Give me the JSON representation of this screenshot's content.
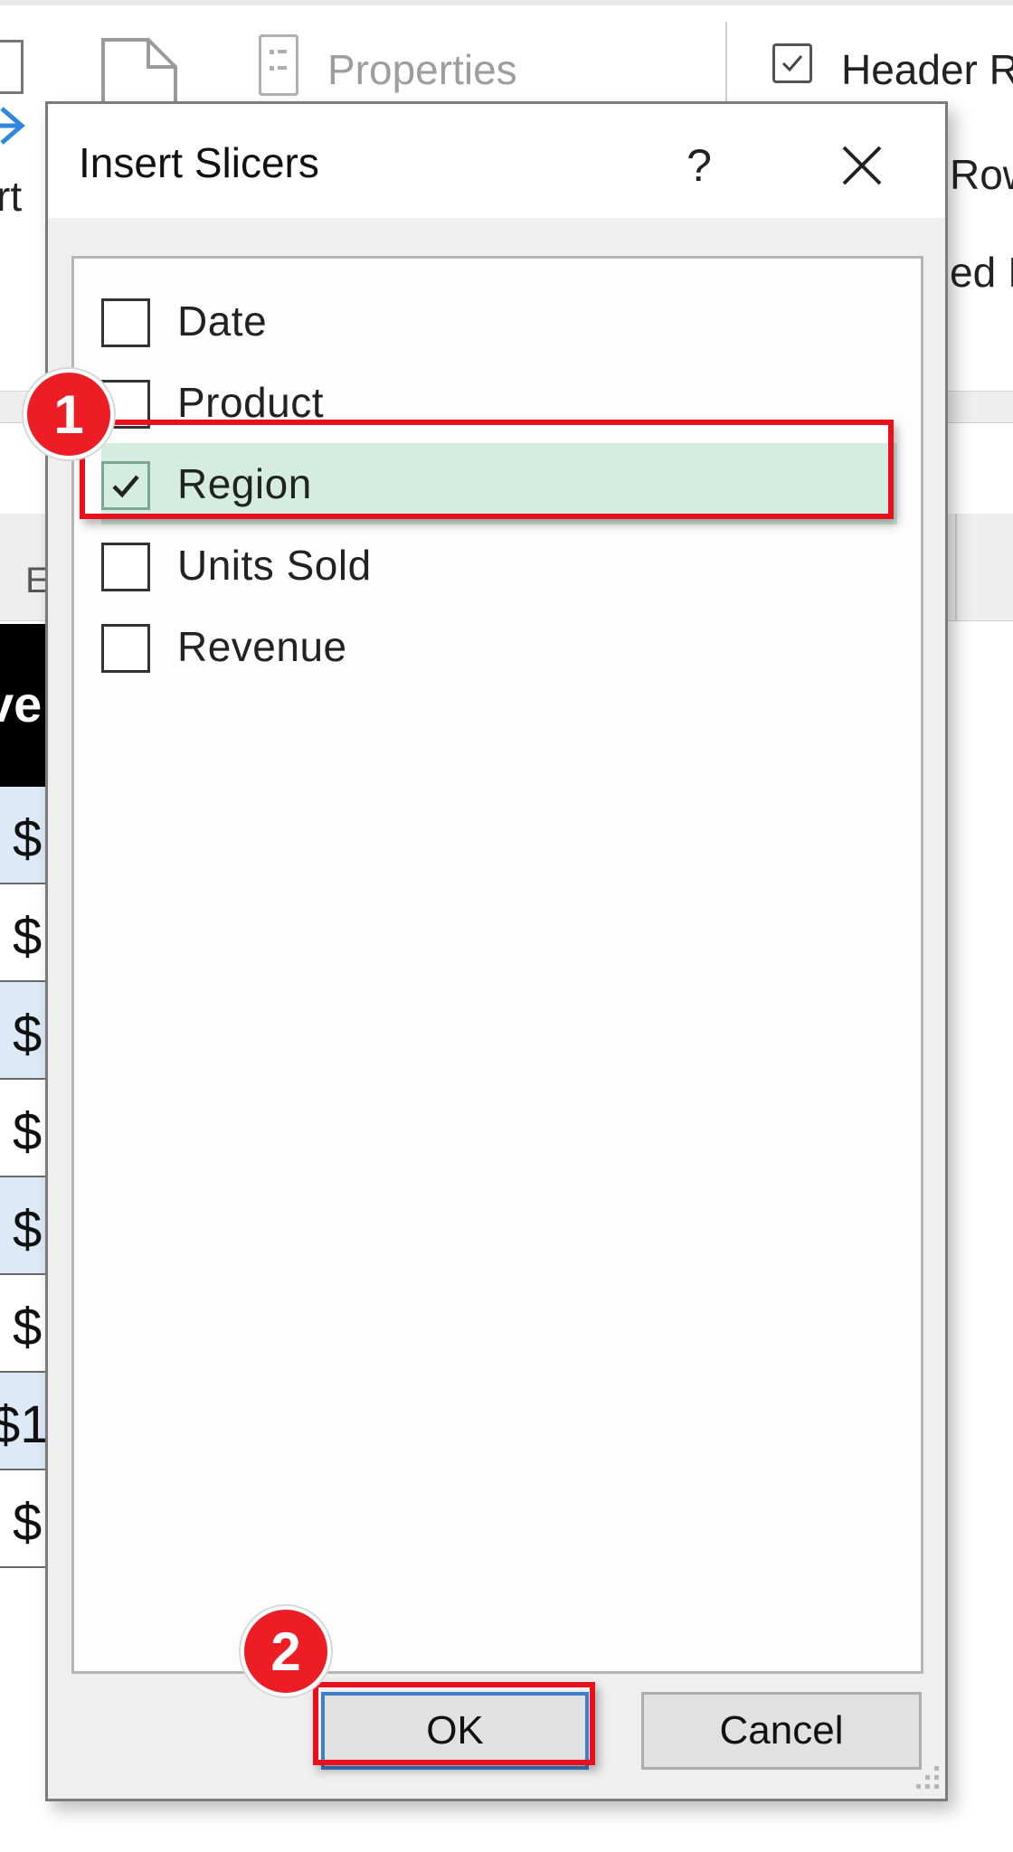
{
  "ribbon": {
    "properties_label": "Properties",
    "header_row_label": "Header R",
    "row_label_fragment": "Row",
    "banded_fragment": "ed I",
    "export_fragment": "rt"
  },
  "sheet": {
    "column_letter": "E",
    "header_fragment": "ve",
    "cells": [
      "$",
      "$",
      "$",
      "$",
      "$",
      "$",
      "$1",
      "$"
    ]
  },
  "dialog": {
    "title": "Insert Slicers",
    "help_label": "?",
    "items": [
      {
        "label": "Date",
        "checked": false
      },
      {
        "label": "Product",
        "checked": false
      },
      {
        "label": "Region",
        "checked": true
      },
      {
        "label": "Units Sold",
        "checked": false
      },
      {
        "label": "Revenue",
        "checked": false
      }
    ],
    "ok_label": "OK",
    "cancel_label": "Cancel"
  },
  "annotations": {
    "step1": "1",
    "step2": "2",
    "highlight_color": "#e8101c"
  },
  "colors": {
    "selected_row": "#d4ece1",
    "cell_blue": "#dde9f6",
    "badge_red": "#ec1d24",
    "ok_border": "#3f7fcf"
  },
  "icons": [
    "table-icon",
    "arrow-right-icon",
    "document-icon",
    "properties-icon",
    "checkbox-icon",
    "help-icon",
    "close-icon",
    "checkmark-icon",
    "resize-grip-icon"
  ]
}
